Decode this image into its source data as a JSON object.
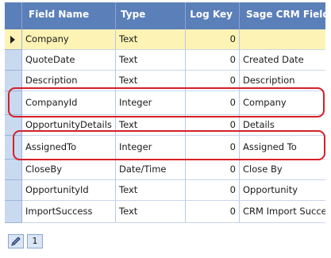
{
  "grid": {
    "columns": [
      {
        "label": "Field Name"
      },
      {
        "label": "Type"
      },
      {
        "label": "Log Key"
      },
      {
        "label": "Sage CRM Field"
      }
    ],
    "rows": [
      {
        "field": "Company",
        "type": "Text",
        "log_key": "0",
        "crm_field": "",
        "selected": true
      },
      {
        "field": "QuoteDate",
        "type": "Text",
        "log_key": "0",
        "crm_field": "Created Date"
      },
      {
        "field": "Description",
        "type": "Text",
        "log_key": "0",
        "crm_field": "Description"
      },
      {
        "field": "CompanyId",
        "type": "Integer",
        "log_key": "0",
        "crm_field": "Company",
        "highlighted": true
      },
      {
        "field": "OpportunityDetails",
        "type": "Text",
        "log_key": "0",
        "crm_field": "Details"
      },
      {
        "field": "AssignedTo",
        "type": "Integer",
        "log_key": "0",
        "crm_field": "Assigned To",
        "highlighted": true
      },
      {
        "field": "CloseBy",
        "type": "Date/Time",
        "log_key": "0",
        "crm_field": "Close By"
      },
      {
        "field": "OpportunityId",
        "type": "Text",
        "log_key": "0",
        "crm_field": "Opportunity"
      },
      {
        "field": "ImportSuccess",
        "type": "Text",
        "log_key": "0",
        "crm_field": "CRM Import Success"
      }
    ],
    "selected_row_marker": "row-selector-arrow-icon"
  },
  "pager": {
    "edit_icon": "pencil-icon",
    "page": "1"
  },
  "colors": {
    "header_bg": "#5b7fb9",
    "selected_row_bg": "#fdf3b4",
    "highlight_outline": "#d4202a"
  }
}
